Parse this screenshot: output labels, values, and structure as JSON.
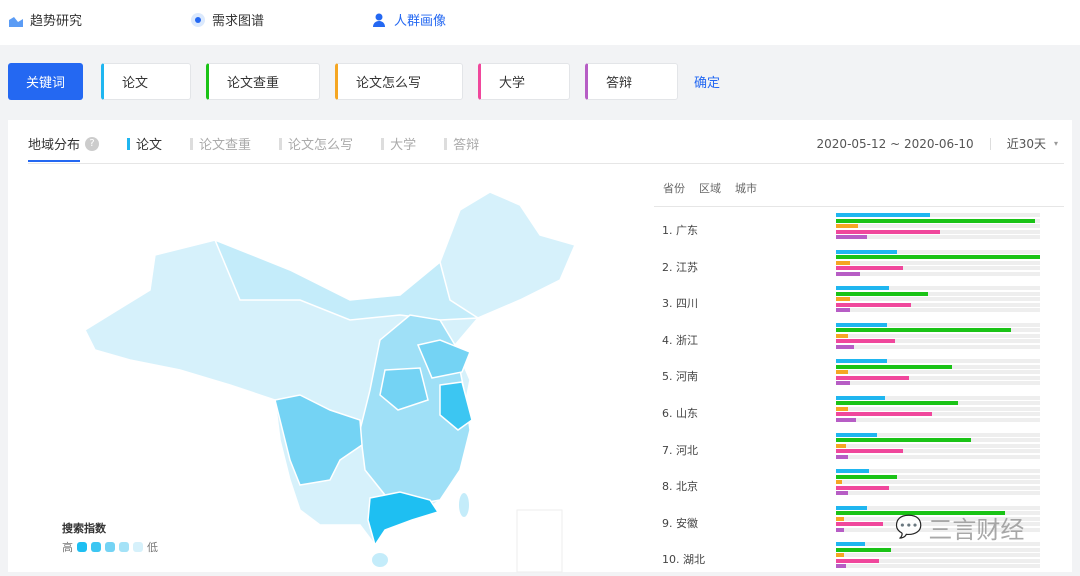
{
  "nav": {
    "trend": "趋势研究",
    "demand": "需求图谱",
    "crowd": "人群画像"
  },
  "keywords": {
    "label": "关键词",
    "items": [
      {
        "text": "论文",
        "color": "#1fb6f0"
      },
      {
        "text": "论文查重",
        "color": "#1ac316"
      },
      {
        "text": "论文怎么写",
        "color": "#f5a623"
      },
      {
        "text": "大学",
        "color": "#f0479c"
      },
      {
        "text": "答辩",
        "color": "#b75dc5"
      }
    ],
    "confirm": "确定"
  },
  "panel": {
    "title": "地域分布",
    "help": "?",
    "tabs": [
      "论文",
      "论文查重",
      "论文怎么写",
      "大学",
      "答辩"
    ],
    "date_range": "2020-05-12 ~ 2020-06-10",
    "period": "近30天",
    "period_arrow": "▾"
  },
  "subtabs": [
    "省份",
    "区域",
    "城市"
  ],
  "legend": {
    "title": "搜索指数",
    "high": "高",
    "low": "低"
  },
  "ranking": [
    {
      "label": "1.  广东",
      "values": [
        0.46,
        0.975,
        0.11,
        0.51,
        0.15
      ]
    },
    {
      "label": "2.  江苏",
      "values": [
        0.3,
        1.0,
        0.07,
        0.33,
        0.12
      ]
    },
    {
      "label": "3.  四川",
      "values": [
        0.26,
        0.45,
        0.07,
        0.37,
        0.07
      ]
    },
    {
      "label": "4.  浙江",
      "values": [
        0.25,
        0.86,
        0.06,
        0.29,
        0.09
      ]
    },
    {
      "label": "5.  河南",
      "values": [
        0.25,
        0.57,
        0.06,
        0.36,
        0.07
      ]
    },
    {
      "label": "6.  山东",
      "values": [
        0.24,
        0.6,
        0.06,
        0.47,
        0.1
      ]
    },
    {
      "label": "7.  河北",
      "values": [
        0.2,
        0.66,
        0.05,
        0.33,
        0.06
      ]
    },
    {
      "label": "8.  北京",
      "values": [
        0.16,
        0.3,
        0.03,
        0.26,
        0.06
      ]
    },
    {
      "label": "9.  安徽",
      "values": [
        0.15,
        0.83,
        0.04,
        0.23,
        0.04
      ]
    },
    {
      "label": "10. 湖北",
      "values": [
        0.14,
        0.27,
        0.04,
        0.21,
        0.05
      ]
    }
  ],
  "watermark": "三言财经"
}
